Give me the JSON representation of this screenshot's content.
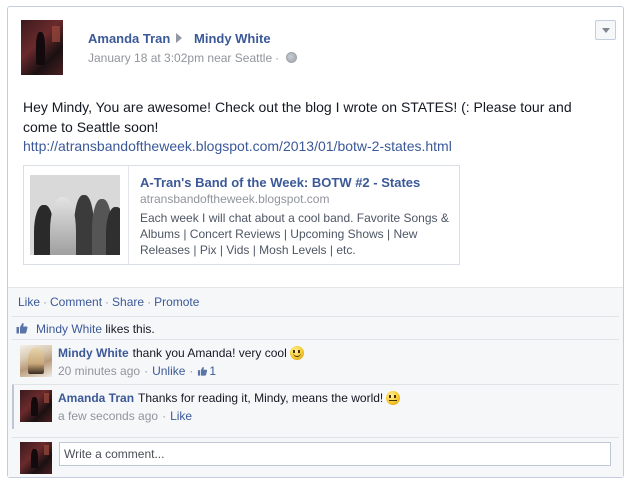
{
  "post": {
    "author": "Amanda Tran",
    "target": "Mindy White",
    "timestamp": "January 18 at 3:02pm near Seattle",
    "meta_sep": "·",
    "privacy_icon": "globe-icon",
    "message": "Hey Mindy, You are awesome! Check out the blog I wrote on STATES! (: Please tour and come to Seattle soon!",
    "link": "http://atransbandoftheweek.blogspot.com/2013/01/botw-2-states.html"
  },
  "shared_link": {
    "title": "A-Tran's Band of the Week: BOTW #2 - States",
    "domain": "atransbandoftheweek.blogspot.com",
    "description": "Each week I will chat about a cool band. Favorite Songs & Albums | Concert Reviews | Upcoming Shows | New Releases | Pix | Vids | Mosh Levels | etc."
  },
  "actions": {
    "like": "Like",
    "comment": "Comment",
    "share": "Share",
    "promote": "Promote",
    "sep": "·"
  },
  "likes": {
    "name": "Mindy White",
    "suffix": " likes this."
  },
  "comments": [
    {
      "author": "Mindy White",
      "text": "thank you Amanda! very cool",
      "emoticon": "smile-icon",
      "time": "20 minutes ago",
      "action": "Unlike",
      "like_count": "1"
    },
    {
      "author": "Amanda Tran",
      "text": "Thanks for reading it, Mindy, means the world!",
      "emoticon": "straight-face-icon",
      "time": "a few seconds ago",
      "action": "Like"
    }
  ],
  "composer": {
    "placeholder": "Write a comment..."
  },
  "colors": {
    "link_blue": "#3b5998",
    "meta_gray": "#90949c",
    "ufi_bg": "#f6f7f9"
  }
}
